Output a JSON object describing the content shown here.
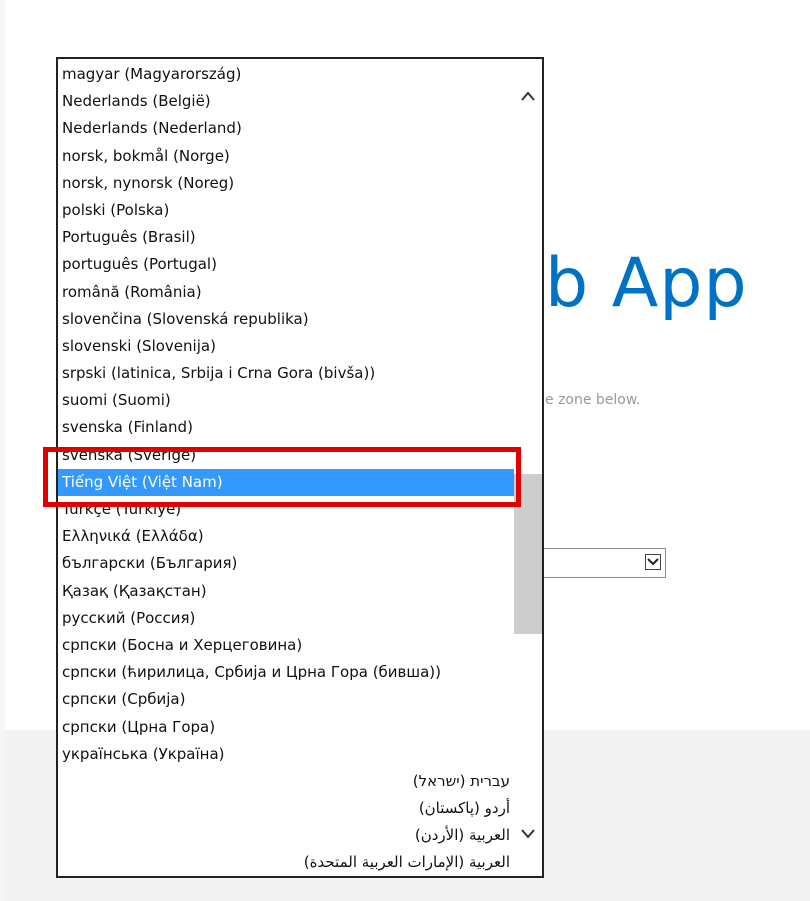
{
  "page": {
    "title_visible": "b App",
    "subtitle_visible": "e zone below."
  },
  "language_dropdown": {
    "selected": "Tiếng Việt (Việt Nam)",
    "options": [
      "magyar (Magyarország)",
      "Nederlands (België)",
      "Nederlands (Nederland)",
      "norsk, bokmål (Norge)",
      "norsk, nynorsk (Noreg)",
      "polski (Polska)",
      "Português (Brasil)",
      "português (Portugal)",
      "română (România)",
      "slovenčina (Slovenská republika)",
      "slovenski (Slovenija)",
      "srpski (latinica, Srbija i Crna Gora (bivša))",
      "suomi (Suomi)",
      "svenska (Finland)",
      "svenska (Sverige)",
      "Tiếng Việt (Việt Nam)",
      "Türkçe (Türkiye)",
      "Ελληνικά (Ελλάδα)",
      "български (България)",
      "Қазақ (Қазақстан)",
      "русский (Россия)",
      "српски (Босна и Херцеговина)",
      "српски (ћирилица, Србија и Црна Гора (бивша))",
      "српски (Србија)",
      "српски (Црна Гора)",
      "українська (Україна)",
      "עברית (ישראל)",
      "أردو (پاکستان)",
      "العربية (الأردن)",
      "العربية (الإمارات العربية المتحدة)"
    ],
    "rtl_from_index": 26
  },
  "colors": {
    "accent": "#0072c6",
    "selection": "#3399ff",
    "annotation": "#e00000"
  },
  "icons": {
    "scroll_up": "chevron-up-icon",
    "scroll_down": "chevron-down-icon",
    "select_arrow": "chevron-down-icon"
  }
}
